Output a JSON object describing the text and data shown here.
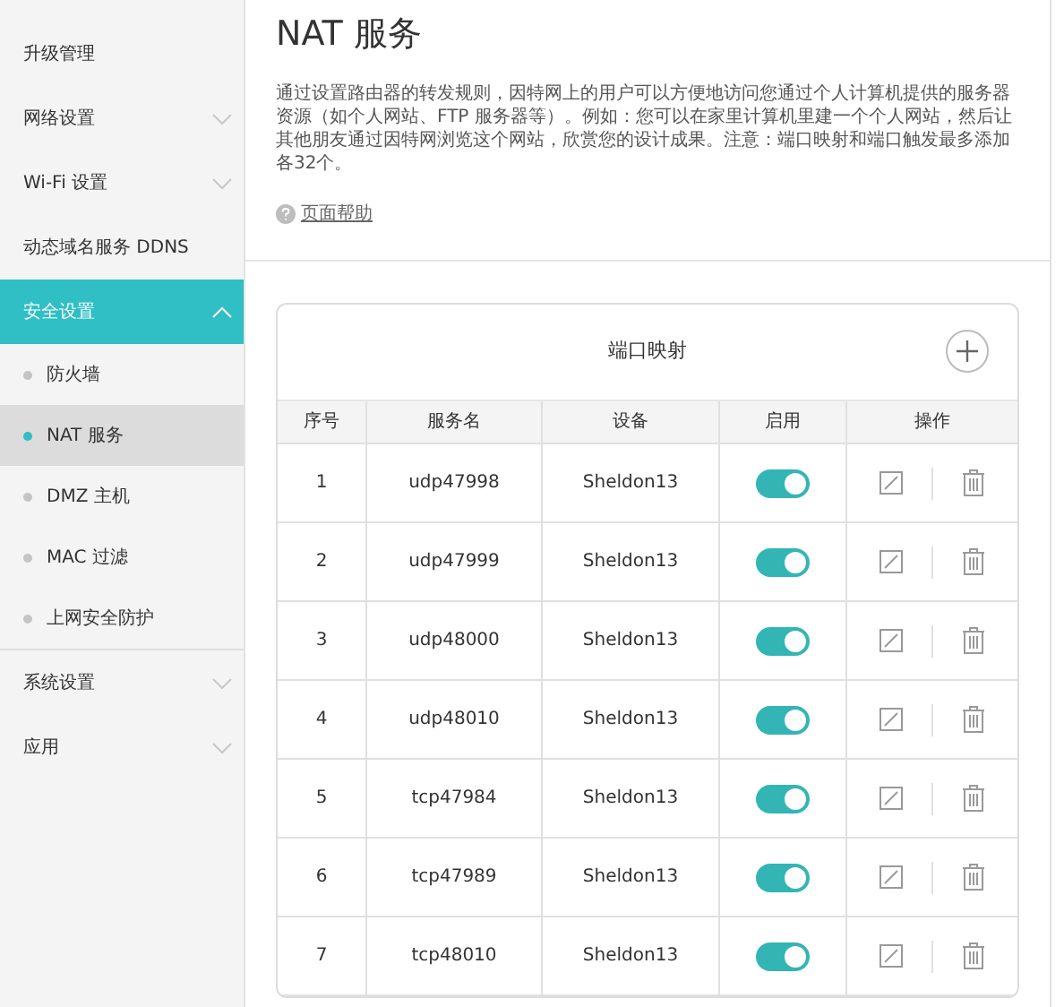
{
  "sidebar": {
    "items": [
      {
        "label": "升级管理",
        "kind": "item",
        "selected": false
      },
      {
        "label": "网络设置",
        "kind": "group",
        "expanded": false,
        "selected": false
      },
      {
        "label": "Wi-Fi 设置",
        "kind": "group",
        "expanded": false,
        "selected": false
      },
      {
        "label": "动态域名服务 DDNS",
        "kind": "item",
        "selected": false
      },
      {
        "label": "安全设置",
        "kind": "group",
        "expanded": true,
        "selected": true,
        "children": [
          {
            "label": "防火墙",
            "selected": false
          },
          {
            "label": "NAT 服务",
            "selected": true
          },
          {
            "label": "DMZ 主机",
            "selected": false
          },
          {
            "label": "MAC 过滤",
            "selected": false
          },
          {
            "label": "上网安全防护",
            "selected": false
          }
        ]
      },
      {
        "label": "系统设置",
        "kind": "group",
        "expanded": false,
        "selected": false
      },
      {
        "label": "应用",
        "kind": "group",
        "expanded": false,
        "selected": false
      }
    ]
  },
  "page": {
    "title": "NAT 服务",
    "description": "通过设置路由器的转发规则，因特网上的用户可以方便地访问您通过个人计算机提供的服务器资源（如个人网站、FTP 服务器等）。例如：您可以在家里计算机里建一个个人网站，然后让其他朋友通过因特网浏览这个网站，欣赏您的设计成果。注意：端口映射和端口触发最多添加各32个。",
    "help_link": "页面帮助"
  },
  "table": {
    "title": "端口映射",
    "columns": [
      "序号",
      "服务名",
      "设备",
      "启用",
      "操作"
    ],
    "rows": [
      {
        "index": "1",
        "service": "udp47998",
        "device": "Sheldon13",
        "enabled": true
      },
      {
        "index": "2",
        "service": "udp47999",
        "device": "Sheldon13",
        "enabled": true
      },
      {
        "index": "3",
        "service": "udp48000",
        "device": "Sheldon13",
        "enabled": true
      },
      {
        "index": "4",
        "service": "udp48010",
        "device": "Sheldon13",
        "enabled": true
      },
      {
        "index": "5",
        "service": "tcp47984",
        "device": "Sheldon13",
        "enabled": true
      },
      {
        "index": "6",
        "service": "tcp47989",
        "device": "Sheldon13",
        "enabled": true
      },
      {
        "index": "7",
        "service": "tcp48010",
        "device": "Sheldon13",
        "enabled": true
      }
    ]
  }
}
